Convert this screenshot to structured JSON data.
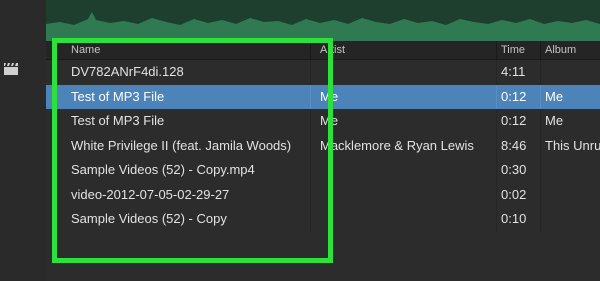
{
  "colors": {
    "highlight": "#2de03b",
    "selection": "#4c83b9",
    "waveform": "#2f7a52",
    "background": "#2c2c2c"
  },
  "sidebar": {
    "icon": "clapperboard-icon"
  },
  "columns": {
    "name": "Name",
    "artist": "Artist",
    "time": "Time",
    "album": "Album"
  },
  "rows": [
    {
      "name": "DV782ANrF4di.128",
      "artist": "",
      "time": "4:11",
      "album": "",
      "selected": false
    },
    {
      "name": "Test of MP3 File",
      "artist": "Me",
      "time": "0:12",
      "album": "Me",
      "selected": true
    },
    {
      "name": "Test of MP3 File",
      "artist": "Me",
      "time": "0:12",
      "album": "Me",
      "selected": false
    },
    {
      "name": "White Privilege II (feat. Jamila Woods)",
      "artist": "Macklemore & Ryan Lewis",
      "time": "8:46",
      "album": "This Unru",
      "selected": false
    },
    {
      "name": "Sample Videos (52) - Copy.mp4",
      "artist": "",
      "time": "0:30",
      "album": "",
      "selected": false
    },
    {
      "name": "video-2012-07-05-02-29-27",
      "artist": "",
      "time": "0:02",
      "album": "",
      "selected": false
    },
    {
      "name": "Sample Videos (52) - Copy",
      "artist": "",
      "time": "0:10",
      "album": "",
      "selected": false
    }
  ]
}
